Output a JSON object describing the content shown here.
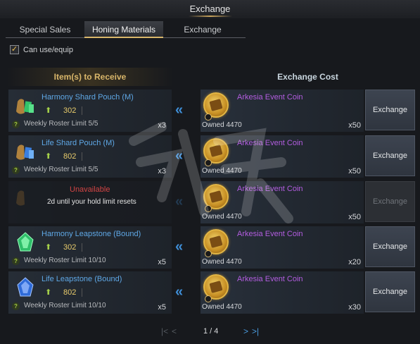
{
  "window": {
    "title": "Exchange"
  },
  "tabs": [
    {
      "label": "Special Sales"
    },
    {
      "label": "Honing Materials"
    },
    {
      "label": "Exchange"
    }
  ],
  "filter": {
    "label": "Can use/equip",
    "checked": true
  },
  "columns": {
    "receive": "Item(s) to Receive",
    "cost": "Exchange Cost"
  },
  "rows": [
    {
      "item": "Harmony Shard Pouch (M)",
      "icon": "shard-pouch-icon",
      "tier_value": "302",
      "limit": "Weekly Roster Limit 5/5",
      "qty": "x3",
      "cost_name": "Arkesia Event Coin",
      "owned": "Owned 4470",
      "cost_qty": "x50",
      "button": "Exchange"
    },
    {
      "item": "Life Shard Pouch (M)",
      "icon": "shard-pouch-icon",
      "tier_value": "802",
      "limit": "Weekly Roster Limit 5/5",
      "qty": "x3",
      "cost_name": "Arkesia Event Coin",
      "owned": "Owned 4470",
      "cost_qty": "x50",
      "button": "Exchange"
    },
    {
      "status": "Unavailable",
      "note": "2d until your hold limit resets",
      "icon": "pouch-icon",
      "cost_name": "Arkesia Event Coin",
      "owned": "Owned 4470",
      "cost_qty": "x50",
      "button": "Exchange"
    },
    {
      "item": "Harmony Leapstone (Bound)",
      "icon": "leapstone-icon",
      "tier_value": "302",
      "limit": "Weekly Roster Limit 10/10",
      "qty": "x5",
      "cost_name": "Arkesia Event Coin",
      "owned": "Owned 4470",
      "cost_qty": "x20",
      "button": "Exchange"
    },
    {
      "item": "Life Leapstone (Bound)",
      "icon": "leapstone-icon",
      "tier_value": "802",
      "limit": "Weekly Roster Limit 10/10",
      "qty": "x5",
      "cost_name": "Arkesia Event Coin",
      "owned": "Owned 4470",
      "cost_qty": "x30",
      "button": "Exchange"
    }
  ],
  "pagination": {
    "current": "1 / 4"
  },
  "colors": {
    "accent_gold": "#d9b66a",
    "item_blue": "#5fa8e6",
    "coin_purple": "#b35de0",
    "unavailable_red": "#d24444"
  }
}
